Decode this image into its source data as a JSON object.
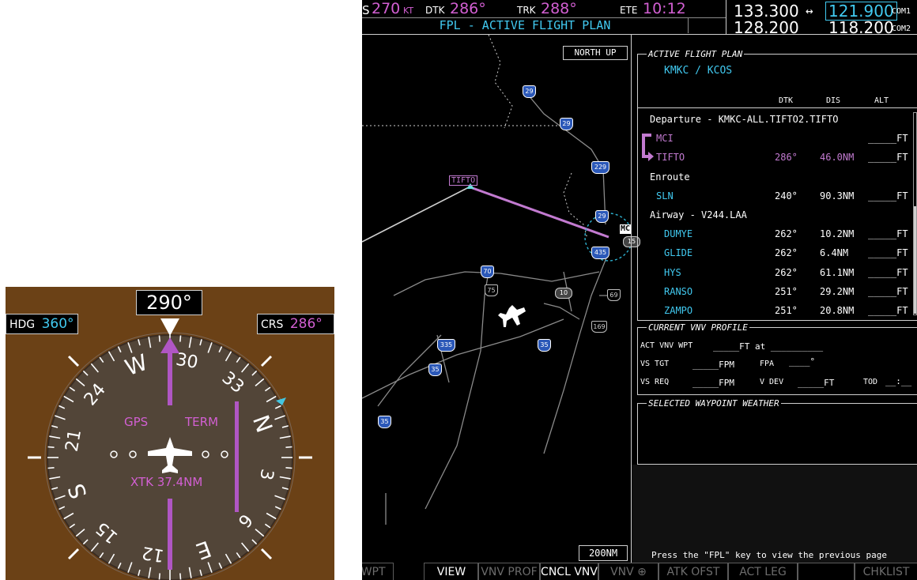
{
  "hsi": {
    "heading_value": "290°",
    "hdg_label": "HDG",
    "hdg_value": "360°",
    "crs_label": "CRS",
    "crs_value": "286°",
    "gps_label": "GPS",
    "term_label": "TERM",
    "xtk_text": "XTK 37.4NM",
    "compass_labels": [
      "N",
      "3",
      "6",
      "E",
      "12",
      "15",
      "S",
      "21",
      "24",
      "W",
      "30",
      "33"
    ],
    "colors": {
      "bezel": "#6b4116",
      "card": "#524538",
      "magenta": "#b056c4",
      "cyan": "#44c6e0"
    }
  },
  "mfd": {
    "topbar": {
      "gs_prefix": "S",
      "gs_value": "270",
      "gs_unit": "KT",
      "dtk_label": "DTK",
      "dtk_value": "286°",
      "trk_label": "TRK",
      "trk_value": "288°",
      "ete_label": "ETE",
      "ete_value": "10:12",
      "page_title": "FPL - ACTIVE FLIGHT PLAN",
      "com_active": "133.300",
      "swap_arrow": "↔",
      "com_standby": "121.900",
      "com1_label": "COM1",
      "com2_active": "128.200",
      "com2_standby": "118.200",
      "com2_label": "COM2"
    },
    "map": {
      "orientation": "NORTH UP",
      "range": "200NM",
      "waypoint_label": "TIFTO",
      "airport_label": "MC",
      "interstates": [
        "29",
        "29",
        "229",
        "29",
        "435",
        "70",
        "335",
        "35",
        "35",
        "35"
      ],
      "us_highways": [
        "75",
        "69",
        "169"
      ],
      "state_highways": [
        "10",
        "15"
      ]
    },
    "fpl": {
      "title": "ACTIVE FLIGHT PLAN",
      "route": "KMKC / KCOS",
      "col_dtk": "DTK",
      "col_dis": "DIS",
      "col_alt": "ALT",
      "rows": [
        {
          "name": "Departure - KMKC-ALL.TIFTO2.TIFTO",
          "dtk": "",
          "dis": "",
          "alt": "",
          "type": "header"
        },
        {
          "name": "MCI",
          "dtk": "",
          "dis": "",
          "alt": "_____FT",
          "type": "wpt"
        },
        {
          "name": "TIFTO",
          "dtk": "286°",
          "dis": "46.0NM",
          "alt": "_____FT",
          "type": "wpt-active"
        },
        {
          "name": "Enroute",
          "dtk": "",
          "dis": "",
          "alt": "",
          "type": "header"
        },
        {
          "name": "SLN",
          "dtk": "240°",
          "dis": "90.3NM",
          "alt": "_____FT",
          "type": "wpt"
        },
        {
          "name": "Airway - V244.LAA",
          "dtk": "",
          "dis": "",
          "alt": "",
          "type": "header"
        },
        {
          "name": "DUMYE",
          "dtk": "262°",
          "dis": "10.2NM",
          "alt": "_____FT",
          "type": "awy"
        },
        {
          "name": "GLIDE",
          "dtk": "262°",
          "dis": "6.4NM",
          "alt": "_____FT",
          "type": "awy"
        },
        {
          "name": "HYS",
          "dtk": "262°",
          "dis": "61.1NM",
          "alt": "_____FT",
          "type": "awy"
        },
        {
          "name": "RANSO",
          "dtk": "251°",
          "dis": "29.2NM",
          "alt": "_____FT",
          "type": "awy"
        },
        {
          "name": "ZAMPO",
          "dtk": "251°",
          "dis": "20.8NM",
          "alt": "_____FT",
          "type": "awy"
        }
      ]
    },
    "vnv": {
      "title": "CURRENT VNV PROFILE",
      "act_wpt_label": "ACT VNV WPT",
      "act_wpt_value": "_____FT at __________",
      "vs_tgt_label": "VS TGT",
      "vs_tgt_value": "_____FPM",
      "fpa_label": "FPA",
      "fpa_value": "____°",
      "vs_req_label": "VS REQ",
      "vs_req_value": "_____FPM",
      "vdev_label": "V DEV",
      "vdev_value": "_____FT",
      "tod_label": "TOD",
      "tod_value": "__:__"
    },
    "weather": {
      "title": "SELECTED WAYPOINT WEATHER"
    },
    "footer": "Press the \"FPL\" key to view the previous page",
    "softkeys": [
      {
        "label": "W WPT",
        "enabled": false
      },
      {
        "label": "VIEW",
        "enabled": true
      },
      {
        "label": "VNV PROF",
        "enabled": false
      },
      {
        "label": "CNCL VNV",
        "enabled": true
      },
      {
        "label": "VNV ⊕",
        "enabled": false
      },
      {
        "label": "ATK OFST",
        "enabled": false
      },
      {
        "label": "ACT LEG",
        "enabled": false
      },
      {
        "label": "",
        "enabled": false
      },
      {
        "label": "CHKLIST",
        "enabled": false
      }
    ]
  }
}
